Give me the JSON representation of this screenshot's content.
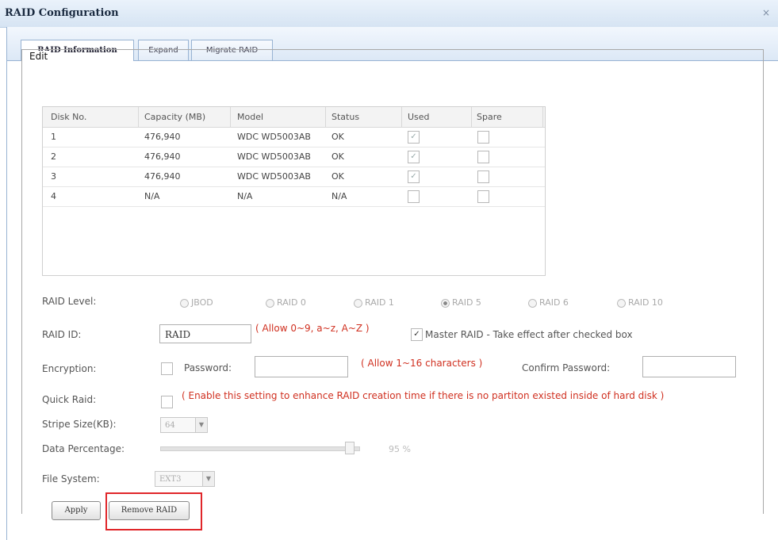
{
  "window": {
    "title": "RAID Configuration",
    "close_glyph": "×"
  },
  "tabs": [
    {
      "label": "RAID Information",
      "active": true
    },
    {
      "label": "Expand",
      "active": false
    },
    {
      "label": "Migrate RAID",
      "active": false
    }
  ],
  "edit": {
    "legend": "Edit"
  },
  "disk_table": {
    "headers": [
      "Disk No.",
      "Capacity (MB)",
      "Model",
      "Status",
      "Used",
      "Spare"
    ],
    "rows": [
      {
        "disk": "1",
        "capacity": "476,940",
        "model": "WDC WD5003AB",
        "status": "OK",
        "used": true,
        "spare": false
      },
      {
        "disk": "2",
        "capacity": "476,940",
        "model": "WDC WD5003AB",
        "status": "OK",
        "used": true,
        "spare": false
      },
      {
        "disk": "3",
        "capacity": "476,940",
        "model": "WDC WD5003AB",
        "status": "OK",
        "used": true,
        "spare": false
      },
      {
        "disk": "4",
        "capacity": "N/A",
        "model": "N/A",
        "status": "N/A",
        "used": false,
        "spare": false
      }
    ]
  },
  "raid_level": {
    "label": "RAID Level:",
    "options": [
      "JBOD",
      "RAID 0",
      "RAID 1",
      "RAID 5",
      "RAID 6",
      "RAID 10"
    ],
    "selected": "RAID 5"
  },
  "raid_id": {
    "label": "RAID ID:",
    "value": "RAID",
    "hint": "( Allow 0~9, a~z, A~Z )",
    "master_label": "Master RAID - Take effect after checked box",
    "master_checked": true
  },
  "encryption": {
    "label": "Encryption:",
    "password_label": "Password:",
    "password_value": "",
    "hint": "( Allow 1~16 characters )",
    "confirm_label": "Confirm Password:",
    "confirm_value": ""
  },
  "quick_raid": {
    "label": "Quick Raid:",
    "note": "( Enable this setting to enhance RAID creation time if there is no partiton existed inside of hard disk )"
  },
  "stripe": {
    "label": "Stripe Size(KB):",
    "value": "64"
  },
  "data_percentage": {
    "label": "Data Percentage:",
    "value_text": "95 %",
    "value": 95
  },
  "file_system": {
    "label": "File System:",
    "value": "EXT3"
  },
  "buttons": {
    "apply": "Apply",
    "remove": "Remove RAID"
  },
  "colors": {
    "highlight_box": "#e0262a",
    "hint_red": "#d03020"
  },
  "icons": {
    "close": "close-icon",
    "dropdown": "chevron-down-icon",
    "check": "checkmark-icon"
  }
}
